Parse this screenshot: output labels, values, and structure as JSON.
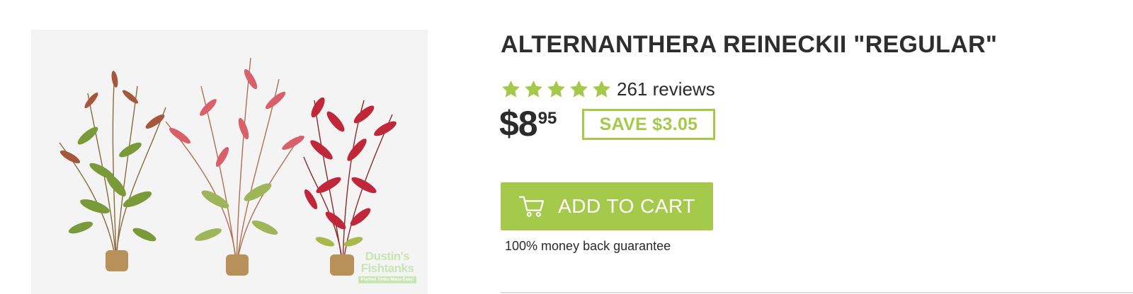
{
  "product": {
    "image_alt": "Alternanthera reineckii plant bunches",
    "title": "ALTERNANTHERA REINECKII \"REGULAR\"",
    "rating": {
      "stars": 5,
      "max_stars": 5,
      "reviews_text": "261 reviews"
    },
    "price": {
      "dollars": "$8",
      "cents": "95"
    },
    "save_label": "SAVE $3.05",
    "add_to_cart_label": "ADD TO CART",
    "guarantee_text": "100% money back guarantee",
    "watermark": {
      "line1": "Dustin's",
      "line2": "Fishtanks",
      "tagline": "Planted Tanks Made Easy!"
    }
  },
  "icons": {
    "star": "star-icon",
    "cart": "cart-icon"
  },
  "colors": {
    "accent": "#a5c94b",
    "text": "#2b2b2b",
    "background": "#ffffff",
    "divider": "#dddddd"
  }
}
